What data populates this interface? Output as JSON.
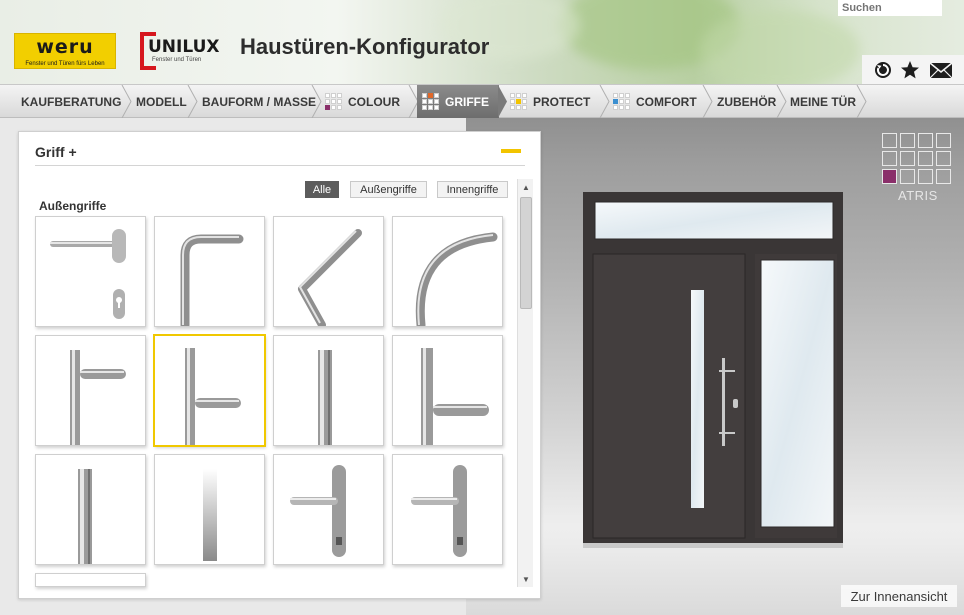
{
  "header": {
    "title": "Haustüren-Konfigurator",
    "search_placeholder": "Suchen",
    "weru_logo": "weru",
    "weru_slogan": "Fenster und Türen fürs Leben",
    "unilux_logo": "UNILUX",
    "unilux_slogan": "Fenster und Türen",
    "icons": [
      "history-icon",
      "star-icon",
      "mail-icon"
    ]
  },
  "nav": {
    "items": [
      {
        "label": "KAUFBERATUNG",
        "swatch": false
      },
      {
        "label": "MODELL",
        "swatch": false
      },
      {
        "label": "BAUFORM / MASSE",
        "swatch": false
      },
      {
        "label": "COLOUR",
        "swatch": true
      },
      {
        "label": "GRIFFE",
        "swatch": true,
        "active": true
      },
      {
        "label": "PROTECT",
        "swatch": true
      },
      {
        "label": "COMFORT",
        "swatch": true
      },
      {
        "label": "ZUBEHÖR",
        "swatch": false
      },
      {
        "label": "MEINE TÜR",
        "swatch": false
      }
    ],
    "swatch_colors": {
      "COLOUR": "#8a2f6a",
      "GRIFFE": "#e0682a",
      "PROTECT": "#f2c400",
      "COMFORT": "#3b8fd0"
    }
  },
  "panel": {
    "title": "Griff +",
    "filters": [
      {
        "label": "Alle",
        "active": true
      },
      {
        "label": "Außengriffe",
        "active": false
      },
      {
        "label": "Innengriffe",
        "active": false
      }
    ],
    "section_label": "Außengriffe",
    "selected_tile": 5,
    "tile_count": 13
  },
  "preview": {
    "model_name": "ATRIS",
    "model_selected_index": 8,
    "accent_color": "#8a2f6a",
    "door_color": "#3f3a3a",
    "innenansicht_label": "Zur Innenansicht"
  }
}
